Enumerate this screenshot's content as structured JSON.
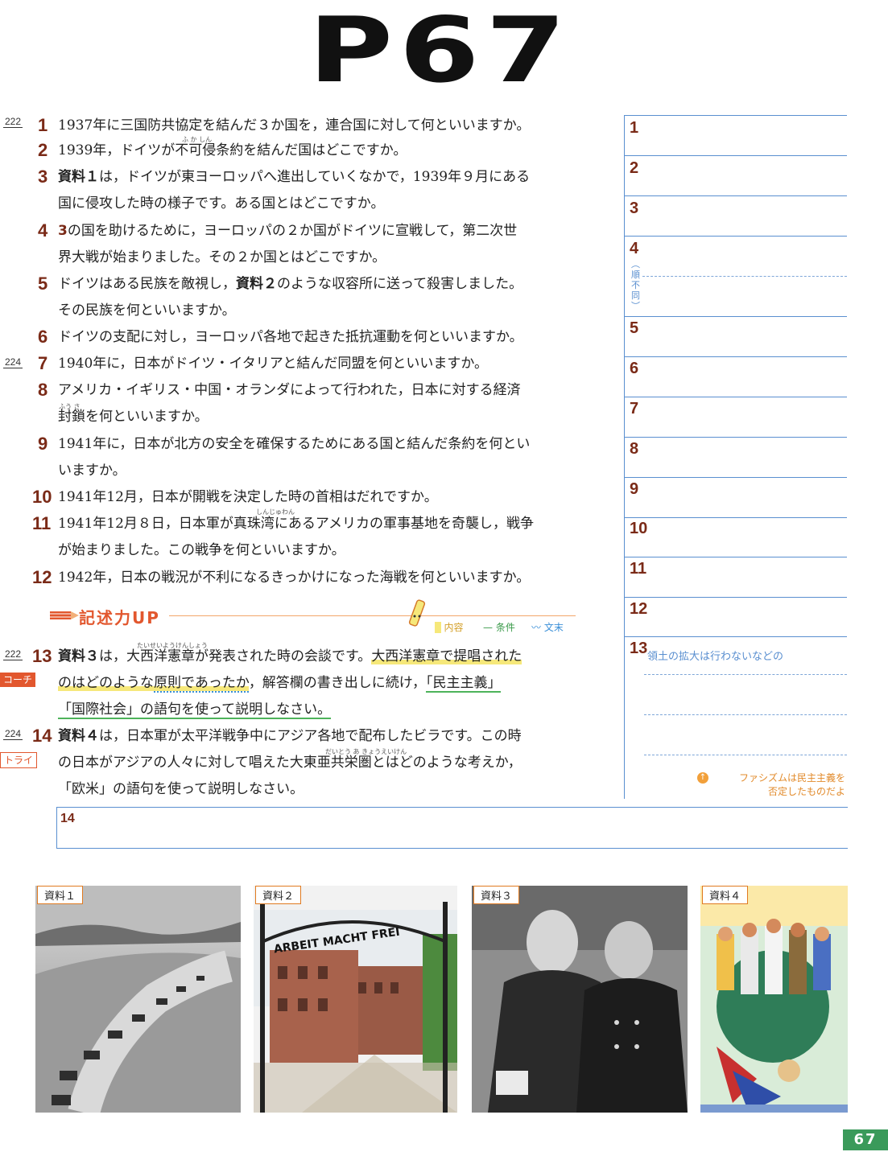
{
  "page_header": "P67",
  "refs": {
    "r222": "222",
    "r224": "224"
  },
  "questions": [
    {
      "num": "1",
      "lines": [
        "1937年に三国防共協定を結んだ３か国を，連合国に対して何といいますか。"
      ]
    },
    {
      "num": "2",
      "lines": [
        "1939年，ドイツが不可侵条約を結んだ国はどこですか。"
      ]
    },
    {
      "num": "3",
      "bold": "資料１",
      "lines": [
        "は，ドイツが東ヨーロッパへ進出していくなかで，1939年９月にある",
        "国に侵攻した時の様子です。ある国とはどこですか。"
      ]
    },
    {
      "num": "4",
      "bold": "3",
      "lines": [
        "の国を助けるために，ヨーロッパの２か国がドイツに宣戦して，第二次世",
        "界大戦が始まりました。その２か国とはどこですか。"
      ]
    },
    {
      "num": "5",
      "lines": [
        "ドイツはある民族を敵視し，",
        "のような収容所に送って殺害しました。",
        "その民族を何といいますか。"
      ],
      "bold": "資料２"
    },
    {
      "num": "6",
      "lines": [
        "ドイツの支配に対し，ヨーロッパ各地で起きた抵抗運動を何といいますか。"
      ]
    },
    {
      "num": "7",
      "lines": [
        "1940年に，日本がドイツ・イタリアと結んだ同盟を何といいますか。"
      ]
    },
    {
      "num": "8",
      "lines": [
        "アメリカ・イギリス・中国・オランダによって行われた，日本に対する経済",
        "封鎖を何といいますか。"
      ]
    },
    {
      "num": "9",
      "lines": [
        "1941年に，日本が北方の安全を確保するためにある国と結んだ条約を何とい",
        "いますか。"
      ]
    },
    {
      "num": "10",
      "lines": [
        "1941年12月，日本が開戦を決定した時の首相はだれですか。"
      ]
    },
    {
      "num": "11",
      "lines": [
        "1941年12月８日，日本軍が真珠湾にあるアメリカの軍事基地を奇襲し，戦争",
        "が始まりました。この戦争を何といいますか。"
      ]
    },
    {
      "num": "12",
      "lines": [
        "1942年，日本の戦況が不利になるきっかけになった海戦を何といいますか。"
      ]
    }
  ],
  "ruby": {
    "fukashin": "ふ か しん",
    "shinjuwan": "しんじゅわん",
    "fuusa": "ふう さ",
    "taiseiyou": "たいせいようけんしょう",
    "daitoua": "だいとう あ きょうえいけん"
  },
  "kijutsu": {
    "label": "記述力UP",
    "legend_content": "内容",
    "legend_condition": "条件",
    "legend_end": "文末"
  },
  "q13": {
    "num": "13",
    "bold": "資料３",
    "line1a": "は，",
    "line1b": "大西洋憲章",
    "line1c": "が発表された時の会談です。",
    "line1d": "大西洋憲章で提唱された",
    "line2a": "のはどのような",
    "line2b": "原則であったか",
    "line2c": "，解答欄の書き出しに続け，",
    "line2d": "「民主主義」",
    "line3": "「国際社会」の語句を使って説明しなさい。",
    "badge": "コーチ"
  },
  "q14": {
    "num": "14",
    "bold": "資料４",
    "line1": "は，日本軍が太平洋戦争中にアジア各地で配布したビラです。この時",
    "line2": "の日本がアジアの人々に対して唱えた大東亜共栄圏とはどのような考えか，",
    "line3": "「欧米」の語句を使って説明しなさい。",
    "badge": "トライ"
  },
  "answers": {
    "labels": [
      "1",
      "2",
      "3",
      "4",
      "5",
      "6",
      "7",
      "8",
      "9",
      "10",
      "11",
      "12",
      "13"
    ],
    "note4": "順不同",
    "a13_start": "領土の拡大は行わないなどの",
    "hint_line1": "ファシズムは民主主義を",
    "hint_line2": "否定したものだよ",
    "a14_label": "14"
  },
  "materials": {
    "m1": "資料１",
    "m2": "資料２",
    "m3": "資料３",
    "m4": "資料４",
    "sign_text": "ARBEIT MACHT FREI"
  },
  "page_number": "67"
}
